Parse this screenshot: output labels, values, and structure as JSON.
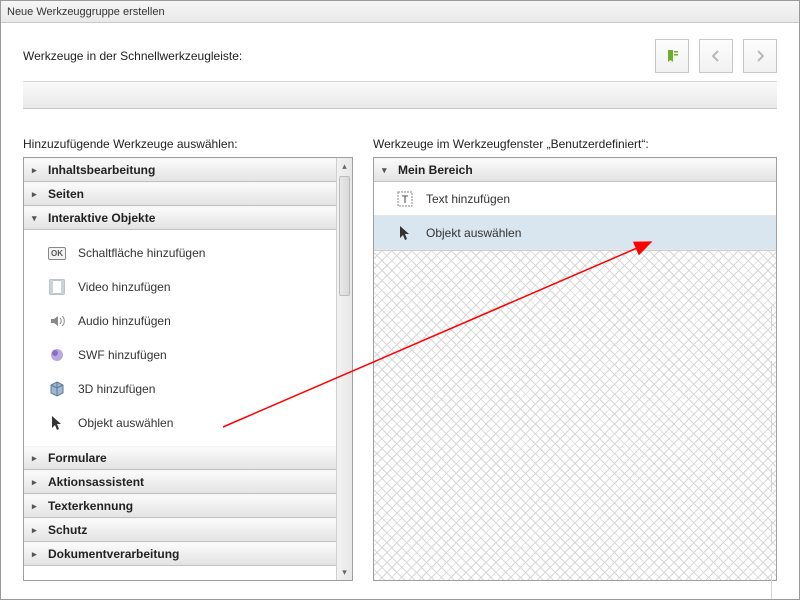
{
  "window": {
    "title": "Neue Werkzeuggruppe erstellen"
  },
  "top": {
    "label": "Werkzeuge in der Schnellwerkzeugleiste:"
  },
  "left": {
    "label": "Hinzuzufügende Werkzeuge auswählen:",
    "sections": [
      {
        "label": "Inhaltsbearbeitung",
        "expanded": false
      },
      {
        "label": "Seiten",
        "expanded": false
      },
      {
        "label": "Interaktive Objekte",
        "expanded": true
      },
      {
        "label": "Formulare",
        "expanded": false
      },
      {
        "label": "Aktionsassistent",
        "expanded": false
      },
      {
        "label": "Texterkennung",
        "expanded": false
      },
      {
        "label": "Schutz",
        "expanded": false
      },
      {
        "label": "Dokumentverarbeitung",
        "expanded": false
      }
    ],
    "interactive_items": [
      {
        "label": "Schaltfläche hinzufügen",
        "icon": "ok"
      },
      {
        "label": "Video hinzufügen",
        "icon": "film"
      },
      {
        "label": "Audio hinzufügen",
        "icon": "speaker"
      },
      {
        "label": "SWF hinzufügen",
        "icon": "swf"
      },
      {
        "label": "3D hinzufügen",
        "icon": "cube"
      },
      {
        "label": "Objekt auswählen",
        "icon": "cursor"
      }
    ]
  },
  "right": {
    "label": "Werkzeuge im Werkzeugfenster „Benutzerdefiniert“:",
    "section": {
      "label": "Mein Bereich"
    },
    "items": [
      {
        "label": "Text hinzufügen",
        "icon": "text",
        "selected": false
      },
      {
        "label": "Objekt auswählen",
        "icon": "cursor",
        "selected": true
      }
    ]
  },
  "annotation": {
    "type": "arrow",
    "color": "#ff0000"
  }
}
